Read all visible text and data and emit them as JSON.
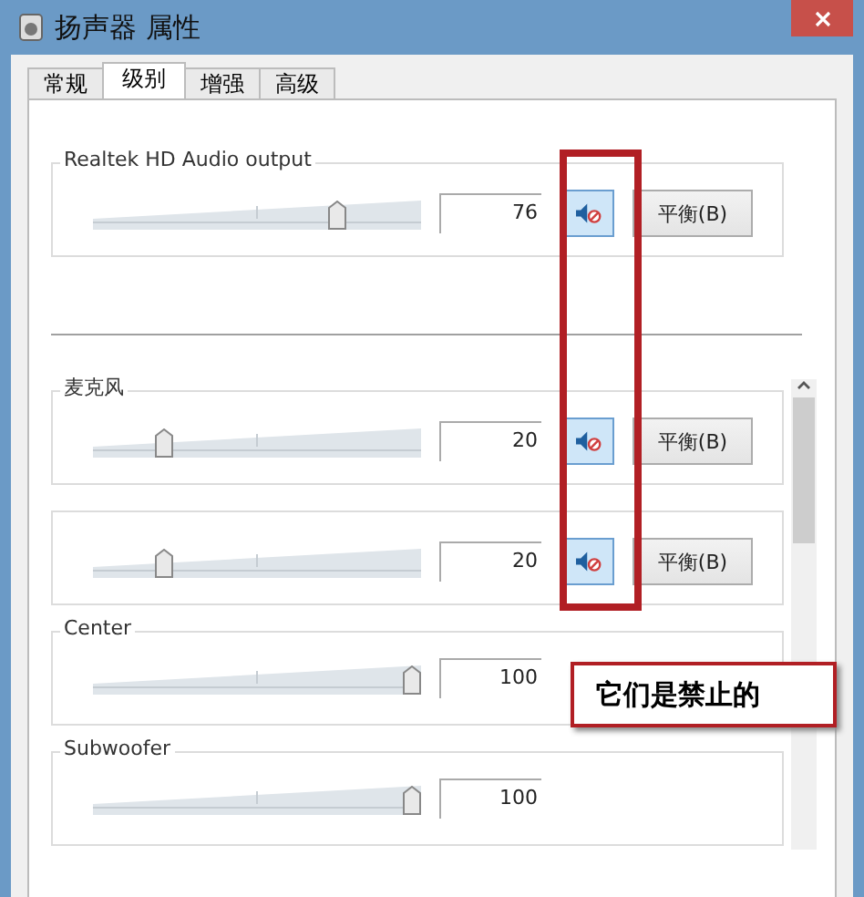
{
  "window": {
    "title": "扬声器 属性"
  },
  "tabs": [
    {
      "label": "常规",
      "selected": false
    },
    {
      "label": "级别",
      "selected": true
    },
    {
      "label": "增强",
      "selected": false
    },
    {
      "label": "高级",
      "selected": false
    }
  ],
  "output": {
    "name": "Realtek HD Audio output",
    "level": 0.76,
    "value": "76",
    "muted": true,
    "balance": "平衡(B)"
  },
  "channels": [
    {
      "kind": "full",
      "name": "麦克风",
      "level": 0.2,
      "value": "20",
      "muted": true,
      "balance": "平衡(B)"
    },
    {
      "kind": "full",
      "level": 0.2,
      "value": "20",
      "muted": true,
      "balance": "平衡(B)"
    },
    {
      "kind": "level_only",
      "name": "Center",
      "level": 1,
      "value": "100"
    },
    {
      "kind": "level_only",
      "name": "Subwoofer",
      "level": 1,
      "value": "100"
    }
  ],
  "annotation": {
    "callout": "它们是禁止的"
  }
}
